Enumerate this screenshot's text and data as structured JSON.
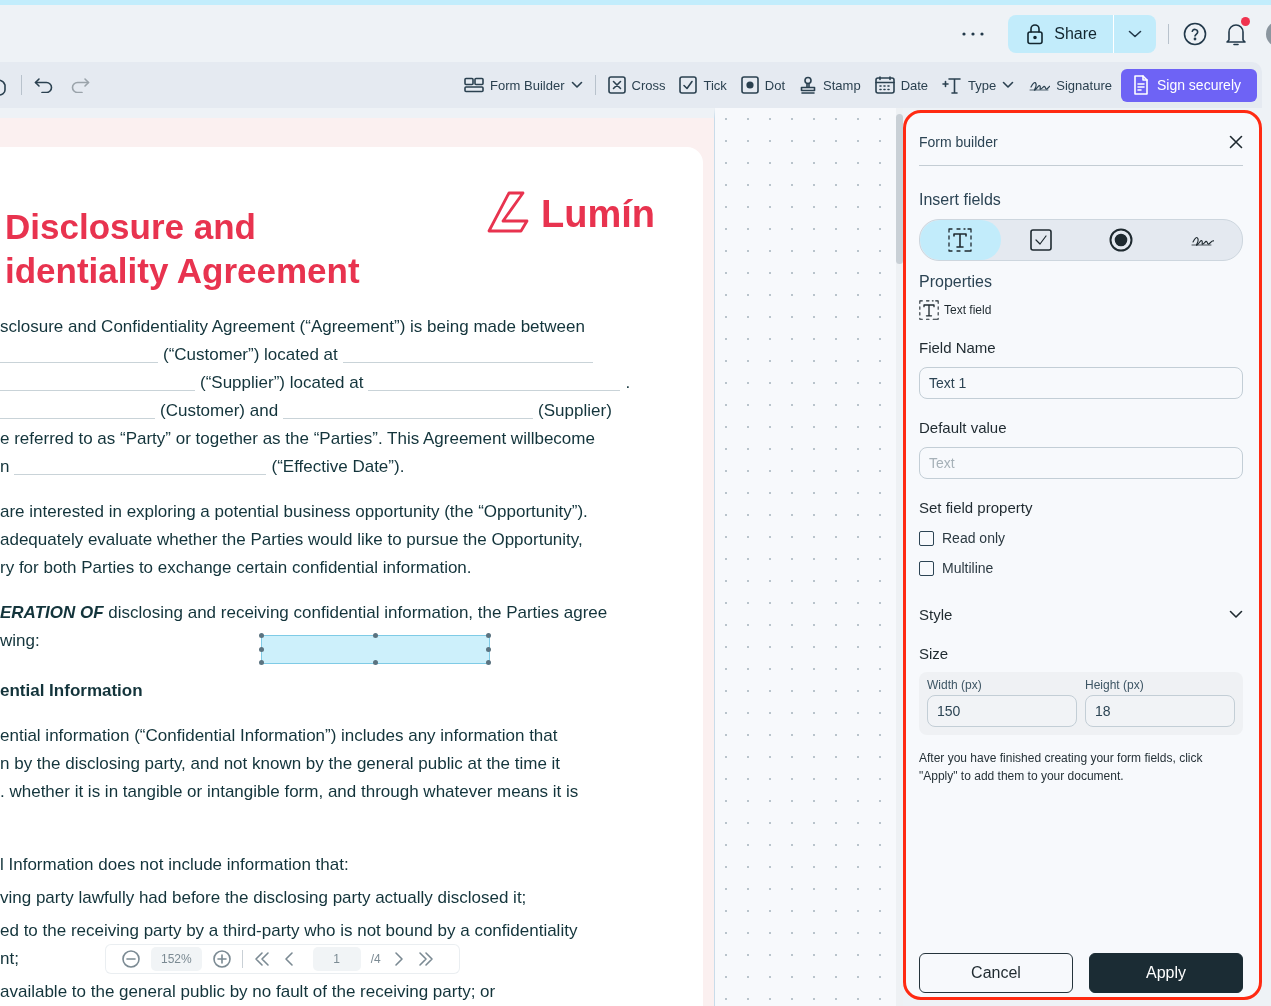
{
  "header": {
    "share": {
      "label": "Share"
    },
    "notifications_unread": true
  },
  "toolbar": {
    "history": [
      {
        "disabled": false
      },
      {
        "disabled": true
      }
    ],
    "tools": [
      {
        "label": "Form Builder",
        "kind": "menu"
      },
      {
        "label": "Cross",
        "kind": "tool"
      },
      {
        "label": "Tick",
        "kind": "tool"
      },
      {
        "label": "Dot",
        "kind": "tool"
      },
      {
        "label": "Stamp",
        "kind": "tool"
      },
      {
        "label": "Date",
        "kind": "tool"
      },
      {
        "label": "Type",
        "kind": "menu"
      },
      {
        "label": "Signature",
        "kind": "tool"
      }
    ],
    "primary": {
      "label": "Sign securely"
    }
  },
  "document": {
    "title_lines": [
      "Disclosure and",
      "identiality Agreement"
    ],
    "logo": "Lumín",
    "blocks": [
      {
        "kind": "paragraph",
        "lines": [
          [
            {
              "text": "sclosure and Confidentiality Agreement (“Agreement”) is being made between"
            }
          ],
          [
            {
              "kind": "blank"
            },
            {
              "text": "(“Customer”) located at"
            },
            {
              "kind": "blank"
            }
          ],
          [
            {
              "kind": "blank"
            },
            {
              "text": "(“Supplier”) located at"
            },
            {
              "kind": "blank"
            },
            {
              "text": "."
            }
          ],
          [
            {
              "kind": "blank"
            },
            {
              "text": "(Customer) and"
            },
            {
              "kind": "blank"
            },
            {
              "text": "(Supplier)"
            }
          ],
          [
            {
              "text": "e referred to as “Party” or together as the “Parties”. This Agreement willbecome"
            }
          ],
          [
            {
              "text": "n"
            },
            {
              "kind": "blank"
            },
            {
              "text": "(“Effective Date”)."
            }
          ]
        ]
      },
      {
        "kind": "paragraph",
        "lines": [
          [
            {
              "text": "are interested in exploring a potential business opportunity (the “Opportunity”)."
            }
          ],
          [
            {
              "text": "adequately evaluate whether the Parties would like to pursue the Opportunity,"
            }
          ],
          [
            {
              "text": "ry for both Parties to exchange certain confidential information."
            }
          ]
        ]
      },
      {
        "kind": "paragraph",
        "lines": [
          [
            {
              "text": "**ERATION OF** disclosing and receiving confidential information, the Parties agree"
            }
          ],
          [
            {
              "text": "wing:"
            }
          ]
        ]
      },
      {
        "kind": "heading",
        "lines": [
          [
            {
              "text": "ential Information"
            }
          ]
        ]
      },
      {
        "kind": "paragraph",
        "lines": [
          [
            {
              "text": "ential information (“Confidential Information”) includes any information that"
            }
          ],
          [
            {
              "text": "n by the disclosing party, and not known by the general public at the time it"
            }
          ],
          [
            {
              "text": ". whether it is in tangible or intangible form, and through whatever means it is"
            }
          ]
        ]
      },
      {
        "kind": "section",
        "lines": [
          [
            {
              "text": "l Information does not include information that:"
            }
          ]
        ]
      },
      {
        "kind": "item",
        "lines": [
          [
            {
              "text": "ving party lawfully had before the disclosing party actually disclosed it;"
            }
          ]
        ]
      },
      {
        "kind": "item",
        "lines": [
          [
            {
              "text": "ed to the receiving party by a third-party who is not bound by a confidentiality"
            }
          ],
          [
            {
              "text": "nt;"
            }
          ]
        ]
      },
      {
        "kind": "item",
        "lines": [
          [
            {
              "text": "available to the general public by no fault of the receiving party; or"
            }
          ]
        ]
      }
    ],
    "selected_field": {
      "selected": true
    }
  },
  "zoom_bar": {
    "zoom": "152%",
    "page": "1",
    "page_count": "/4"
  },
  "panel": {
    "title": "Form builder",
    "insert_fields": {
      "label": "Insert fields",
      "options": [
        {
          "selected": true
        },
        {
          "selected": false
        },
        {
          "selected": false
        },
        {
          "selected": false
        }
      ]
    },
    "properties": {
      "label": "Properties",
      "type_label": "Text field"
    },
    "field_name": {
      "label": "Field Name",
      "value": "Text 1"
    },
    "default_value": {
      "label": "Default value",
      "placeholder": "Text"
    },
    "field_property": {
      "label": "Set field property",
      "options": [
        {
          "label": "Read only",
          "checked": false
        },
        {
          "label": "Multiline",
          "checked": false
        }
      ]
    },
    "style": {
      "label": "Style",
      "expanded": false
    },
    "size": {
      "label": "Size",
      "width": {
        "label": "Width (px)",
        "value": "150"
      },
      "height": {
        "label": "Height (px)",
        "value": "18"
      }
    },
    "hint": "After you have finished creating your form fields, click \"Apply\" to add them to your document.",
    "buttons": {
      "cancel": "Cancel",
      "apply": "Apply"
    }
  }
}
